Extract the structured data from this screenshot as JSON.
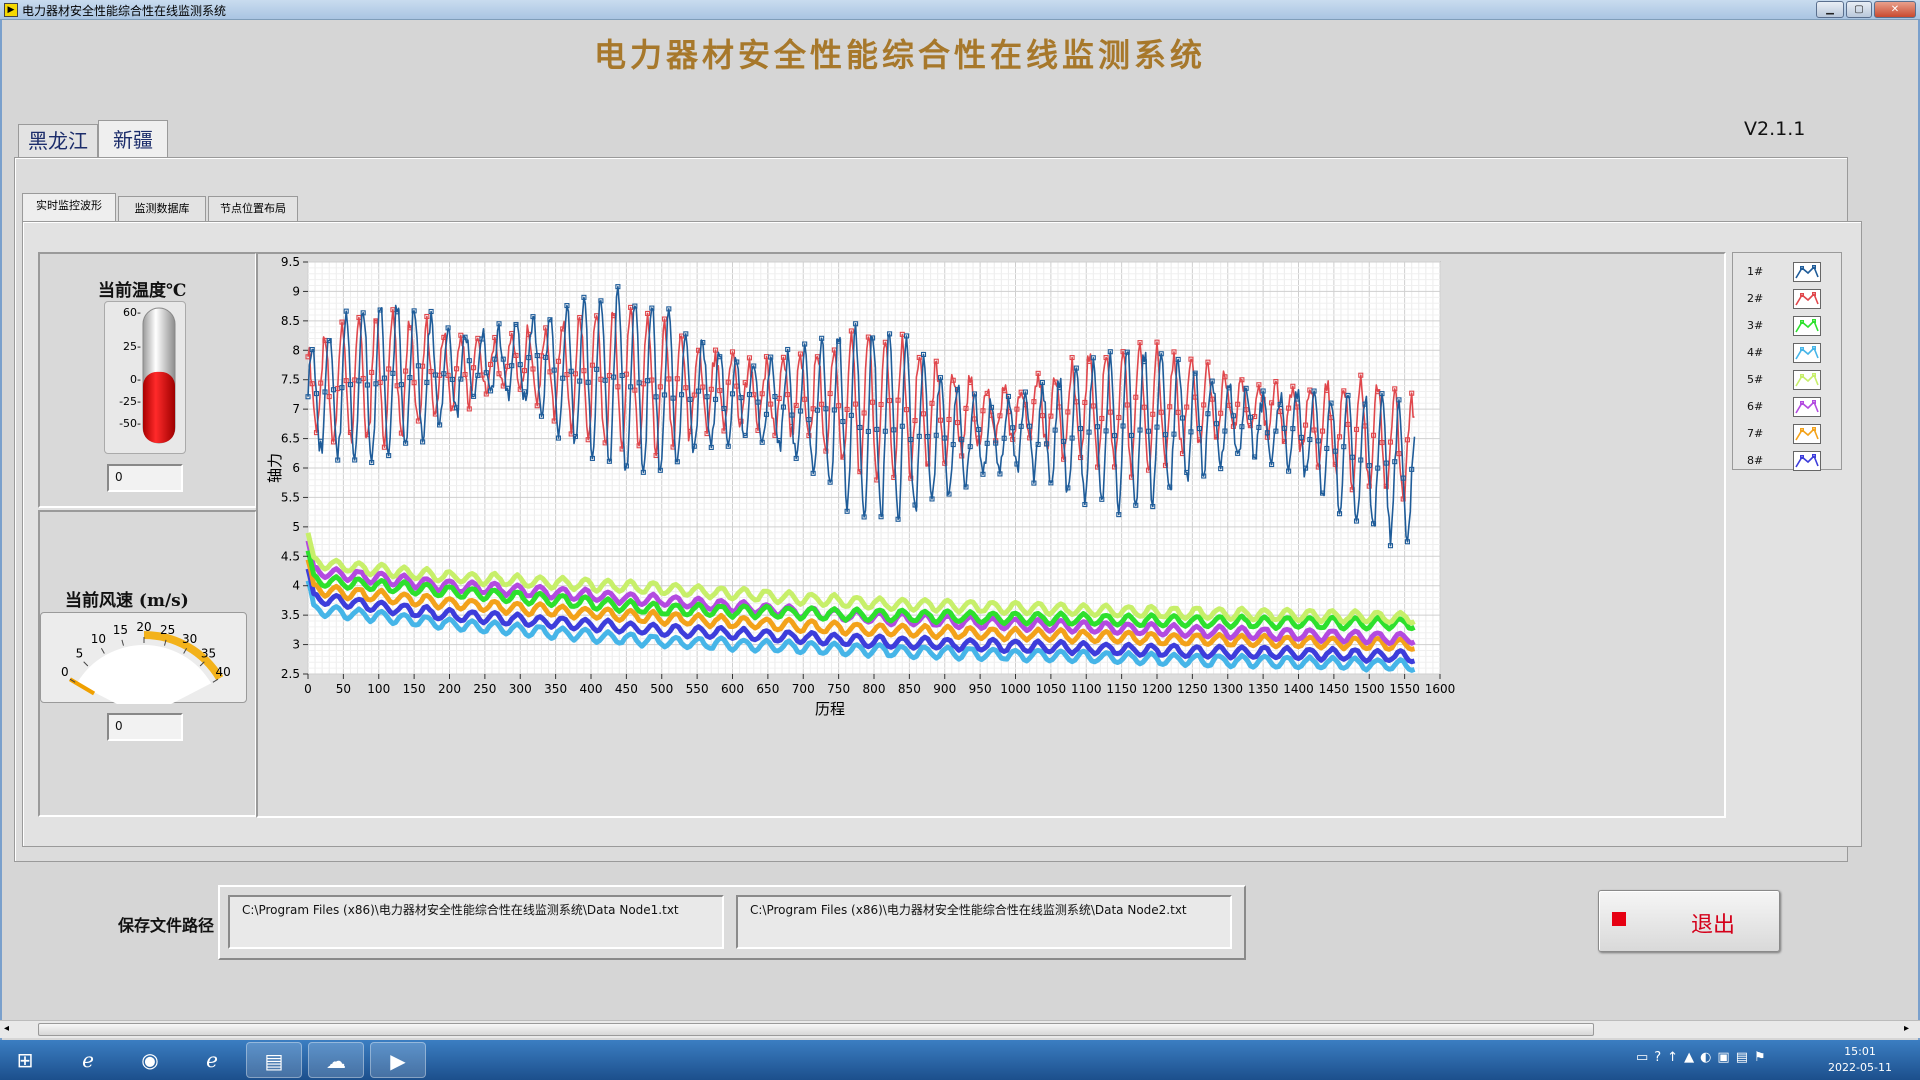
{
  "window": {
    "title": "电力器材安全性能综合性在线监测系统"
  },
  "app": {
    "title": "电力器材安全性能综合性在线监测系统",
    "version": "V2.1.1"
  },
  "region_tabs": [
    {
      "label": "黑龙江",
      "selected": false
    },
    {
      "label": "新疆",
      "selected": true
    }
  ],
  "view_tabs": [
    {
      "label": "实时监控波形",
      "selected": true
    },
    {
      "label": "监测数据库",
      "selected": false
    },
    {
      "label": "节点位置布局",
      "selected": false
    }
  ],
  "temperature": {
    "label": "当前温度℃",
    "ticks": [
      "60-",
      "25-",
      "0-",
      "-25-",
      "-50-"
    ],
    "value": "0",
    "level_celsius": 0
  },
  "wind": {
    "label": "当前风速 (m/s)",
    "ticks": [
      "0",
      "5",
      "10",
      "15",
      "20",
      "25",
      "30",
      "35",
      "40"
    ],
    "value": "0",
    "level": 0
  },
  "legend": [
    {
      "name": "1#",
      "color": "#1f5c99"
    },
    {
      "name": "2#",
      "color": "#e0474c"
    },
    {
      "name": "3#",
      "color": "#2de02d"
    },
    {
      "name": "4#",
      "color": "#46b5e8"
    },
    {
      "name": "5#",
      "color": "#c7ef6a"
    },
    {
      "name": "6#",
      "color": "#b34be0"
    },
    {
      "name": "7#",
      "color": "#f3a21a"
    },
    {
      "name": "8#",
      "color": "#3d3ddb"
    }
  ],
  "chart_data": {
    "type": "line",
    "xlabel": "历程",
    "ylabel": "轴力",
    "xlim": [
      0,
      1600
    ],
    "ylim": [
      2.5,
      9.5
    ],
    "xticks": [
      0,
      50,
      100,
      150,
      200,
      250,
      300,
      350,
      400,
      450,
      500,
      550,
      600,
      650,
      700,
      750,
      800,
      850,
      900,
      950,
      1000,
      1050,
      1100,
      1150,
      1200,
      1250,
      1300,
      1350,
      1400,
      1450,
      1500,
      1550,
      1600
    ],
    "yticks": [
      2.5,
      3,
      3.5,
      4,
      4.5,
      5,
      5.5,
      6,
      6.5,
      7,
      7.5,
      8,
      8.5,
      9,
      9.5
    ],
    "grid": true,
    "x_end": 1565,
    "series": [
      {
        "name": "1#",
        "trend": [
          [
            0,
            7.2
          ],
          [
            100,
            7.5
          ],
          [
            300,
            7.8
          ],
          [
            500,
            7.3
          ],
          [
            700,
            7.0
          ],
          [
            900,
            6.5
          ],
          [
            1100,
            6.6
          ],
          [
            1300,
            6.8
          ],
          [
            1400,
            6.6
          ],
          [
            1565,
            5.8
          ]
        ],
        "amplitude": [
          [
            0,
            1.2
          ],
          [
            400,
            1.5
          ],
          [
            800,
            1.6
          ],
          [
            1200,
            1.3
          ],
          [
            1565,
            1.1
          ]
        ]
      },
      {
        "name": "2#",
        "trend": [
          [
            0,
            7.3
          ],
          [
            100,
            7.5
          ],
          [
            300,
            7.8
          ],
          [
            500,
            7.4
          ],
          [
            700,
            7.2
          ],
          [
            900,
            6.9
          ],
          [
            1100,
            7.0
          ],
          [
            1300,
            7.1
          ],
          [
            1400,
            6.9
          ],
          [
            1565,
            6.3
          ]
        ],
        "amplitude": [
          [
            0,
            1.0
          ],
          [
            400,
            1.2
          ],
          [
            800,
            1.2
          ],
          [
            1200,
            1.0
          ],
          [
            1565,
            0.9
          ]
        ]
      },
      {
        "name": "3#",
        "trend": [
          [
            0,
            4.1
          ],
          [
            200,
            3.9
          ],
          [
            500,
            3.6
          ],
          [
            800,
            3.5
          ],
          [
            1200,
            3.4
          ],
          [
            1565,
            3.35
          ]
        ]
      },
      {
        "name": "4#",
        "trend": [
          [
            0,
            3.6
          ],
          [
            200,
            3.35
          ],
          [
            500,
            3.05
          ],
          [
            800,
            2.9
          ],
          [
            1200,
            2.75
          ],
          [
            1565,
            2.65
          ]
        ]
      },
      {
        "name": "5#",
        "trend": [
          [
            0,
            4.4
          ],
          [
            200,
            4.15
          ],
          [
            500,
            3.95
          ],
          [
            800,
            3.7
          ],
          [
            1200,
            3.55
          ],
          [
            1565,
            3.45
          ]
        ]
      },
      {
        "name": "6#",
        "trend": [
          [
            0,
            4.25
          ],
          [
            200,
            4.0
          ],
          [
            500,
            3.75
          ],
          [
            800,
            3.45
          ],
          [
            1200,
            3.25
          ],
          [
            1565,
            3.1
          ]
        ]
      },
      {
        "name": "7#",
        "trend": [
          [
            0,
            3.95
          ],
          [
            200,
            3.7
          ],
          [
            500,
            3.45
          ],
          [
            800,
            3.25
          ],
          [
            1200,
            3.1
          ],
          [
            1565,
            3.0
          ]
        ]
      },
      {
        "name": "8#",
        "trend": [
          [
            0,
            3.8
          ],
          [
            200,
            3.5
          ],
          [
            500,
            3.25
          ],
          [
            800,
            3.05
          ],
          [
            1200,
            2.9
          ],
          [
            1565,
            2.8
          ]
        ]
      }
    ]
  },
  "save": {
    "label": "保存文件路径",
    "path1": "C:\\Program Files (x86)\\电力器材安全性能综合性在线监测系统\\Data Node1.txt",
    "path2": "C:\\Program Files (x86)\\电力器材安全性能综合性在线监测系统\\Data Node2.txt"
  },
  "exit": {
    "label": "退出"
  },
  "taskbar": {
    "time": "15:01",
    "date": "2022-05-11"
  }
}
